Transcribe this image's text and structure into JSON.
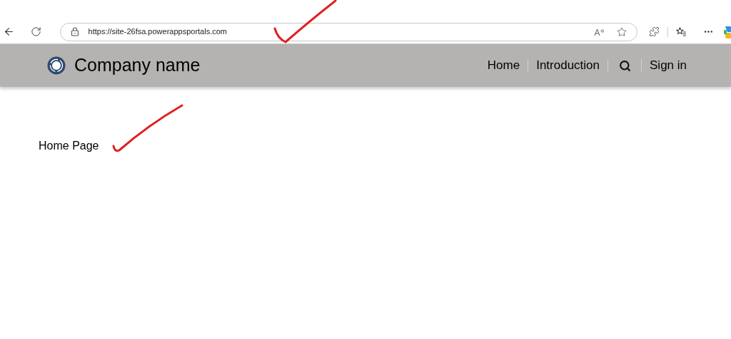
{
  "browser": {
    "url": "https://site-26fsa.powerappsportals.com"
  },
  "header": {
    "brand": "Company name",
    "nav": [
      {
        "label": "Home",
        "kind": "link"
      },
      {
        "label": "Introduction",
        "kind": "link"
      },
      {
        "kind": "search"
      },
      {
        "label": "Sign in",
        "kind": "link"
      }
    ]
  },
  "main": {
    "heading": "Home Page"
  }
}
